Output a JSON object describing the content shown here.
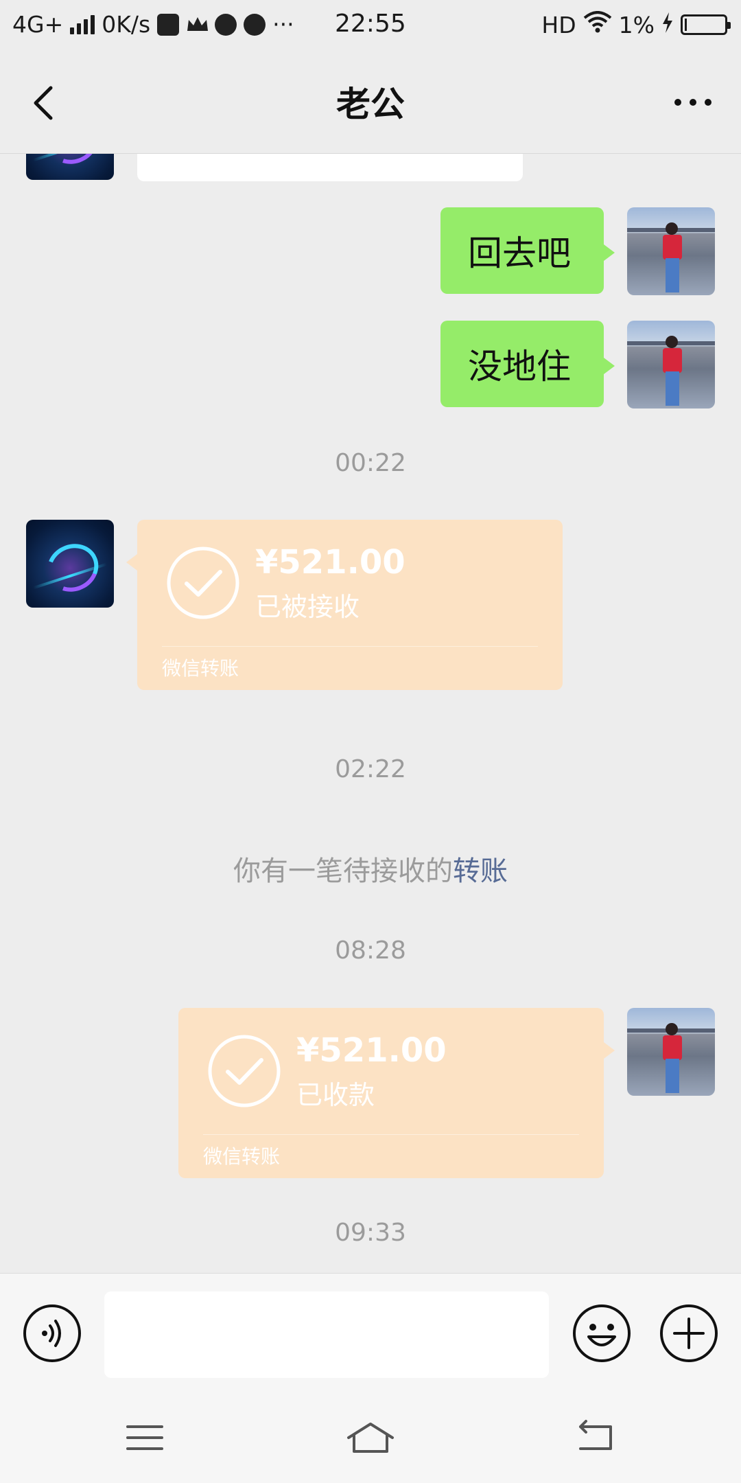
{
  "status_bar": {
    "network": "4G+",
    "speed": "0K/s",
    "time": "22:55",
    "hd": "HD",
    "battery": "1%"
  },
  "header": {
    "title": "老公",
    "back_icon": "chevron-left-icon",
    "more_icon": "more-dots-icon"
  },
  "messages": {
    "top_partial_text": "",
    "m1": "回去吧",
    "m2": "没地住",
    "time1": "00:22",
    "transfer1": {
      "amount": "¥521.00",
      "status": "已被接收",
      "caption": "微信转账"
    },
    "time2": "02:22",
    "system_tip": {
      "text": "你有一笔待接收的",
      "link": "转账"
    },
    "time3": "08:28",
    "transfer2": {
      "amount": "¥521.00",
      "status": "已收款",
      "caption": "微信转账"
    },
    "time4": "09:33"
  },
  "input_bar": {
    "voice_icon": "voice-icon",
    "input_value": "",
    "emoji_icon": "emoji-icon",
    "plus_icon": "plus-icon"
  },
  "nav_bar": {
    "menu_icon": "menu-icon",
    "home_icon": "home-icon",
    "back_icon": "back-icon"
  },
  "colors": {
    "chat_bg": "#ededed",
    "green_bubble": "#95ec69",
    "transfer_bg": "#fce2c4",
    "link": "#576b95"
  }
}
